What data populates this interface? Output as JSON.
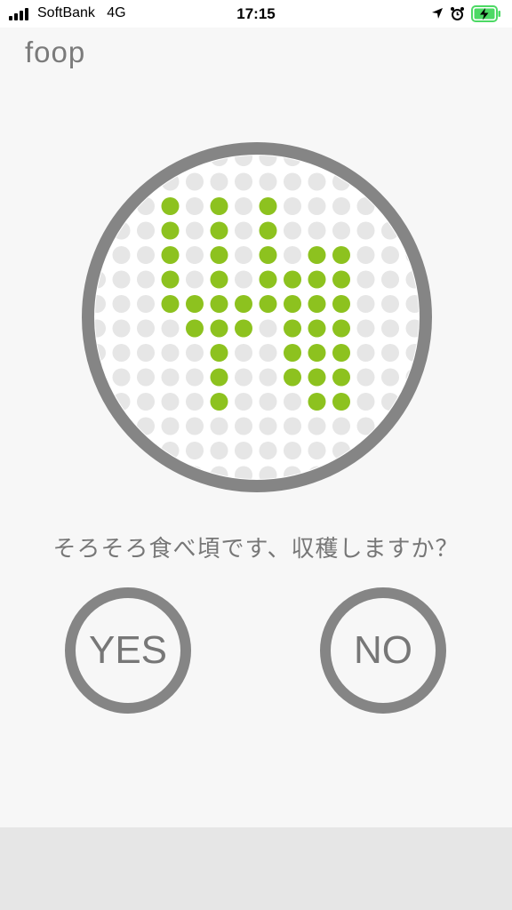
{
  "status_bar": {
    "carrier": "SoftBank",
    "network": "4G",
    "time": "17:15",
    "icons": [
      "signal-icon",
      "location-arrow-icon",
      "alarm-clock-icon",
      "battery-charging-icon"
    ]
  },
  "app": {
    "logo": "foop"
  },
  "display": {
    "icon": "plant-sprout-dot-matrix-icon",
    "colors": {
      "ring": "#858585",
      "dot_off": "#e6e6e6",
      "dot_on": "#8dc21f"
    }
  },
  "prompt": {
    "text": "そろそろ食べ頃です、収穫しますか？"
  },
  "buttons": {
    "yes": "YES",
    "no": "NO"
  }
}
